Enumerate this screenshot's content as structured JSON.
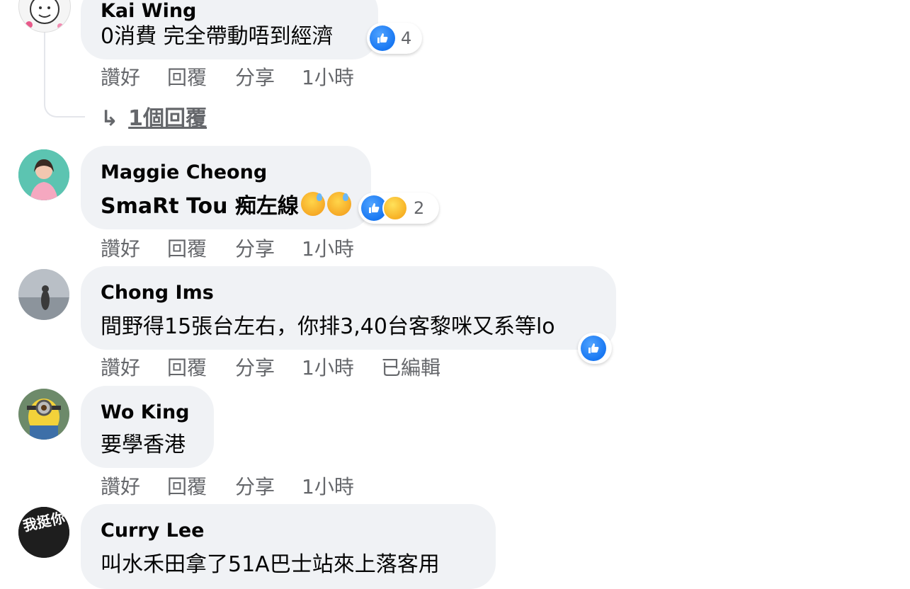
{
  "comments": [
    {
      "name": "Kai Wing",
      "text": "0消費 完全帶動唔到經濟",
      "reaction_count": "4",
      "actions": [
        "讚好",
        "回覆",
        "分享",
        "1小時"
      ],
      "replies_link": "1個回覆"
    },
    {
      "name": "Maggie Cheong",
      "text": "SmaRt Tou 痴左線",
      "emojis": [
        "downcast-sweat-emoji",
        "downcast-sweat-emoji"
      ],
      "reaction_count": "2",
      "actions": [
        "讚好",
        "回覆",
        "分享",
        "1小時"
      ]
    },
    {
      "name": "Chong Ims",
      "text": "間野得15張台左右，你排3,40台客黎咪又系等lo",
      "actions": [
        "讚好",
        "回覆",
        "分享",
        "1小時",
        "已編輯"
      ]
    },
    {
      "name": "Wo King",
      "text": "要學香港",
      "actions": [
        "讚好",
        "回覆",
        "分享",
        "1小時"
      ]
    },
    {
      "name": "Curry Lee",
      "text": "叫水禾田拿了51A巴士站來上落客用"
    }
  ],
  "avatar_badge_text": "我挺你",
  "colors": {
    "bubble": "#f0f2f5",
    "meta_text": "#65676b",
    "like_blue": "#1877f2",
    "haha_yellow": "#f7b125"
  }
}
